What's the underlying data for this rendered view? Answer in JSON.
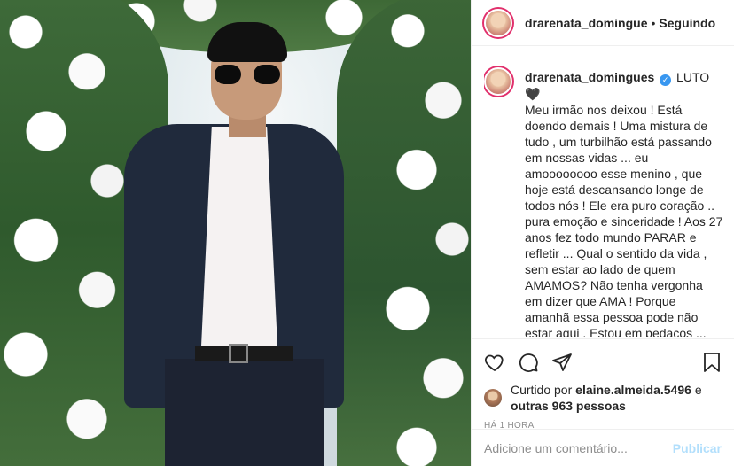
{
  "header": {
    "username": "drarenata_domingue",
    "separator": "•",
    "follow_status": "Seguindo"
  },
  "caption": {
    "username": "drarenata_domingues",
    "verified_glyph": "✓",
    "lead": "LUTO",
    "heart": "🖤",
    "text": "Meu irmão nos deixou ! Está doendo demais ! Uma mistura de tudo , um turbilhão está passando em nossas vidas ... eu amoooooooo esse menino , que hoje está descansando longe de todos nós ! Ele era puro coração .. pura emoção e sinceridade ! Aos 27 anos fez todo mundo PARAR e refletir ... Qual o sentido da vida , sem estar ao lado de quem AMAMOS? Não tenha vergonha em dizer que AMA ! Porque amanhã essa pessoa pode não estar aqui . Estou em pedaços ... você Dr Eduardo , Eduardinho , Mano , Maninho , é o melhor ser humano que já conheci ! Ficou um buraco e nunca mais serei a mesma 🖤"
  },
  "likes": {
    "prefix": "Curtido por",
    "user": "elaine.almeida.5496",
    "connector": "e",
    "others": "outras 963 pessoas"
  },
  "timestamp": "HÁ 1 HORA",
  "comment": {
    "placeholder": "Adicione um comentário...",
    "publish_label": "Publicar"
  },
  "colors": {
    "accent": "#3897f0",
    "publish_disabled": "#b2dffc",
    "muted": "#8e8e8e",
    "story_ring": "#e1306c"
  },
  "icons": [
    "heart-icon",
    "comment-icon",
    "share-icon",
    "bookmark-icon",
    "verified-icon"
  ]
}
